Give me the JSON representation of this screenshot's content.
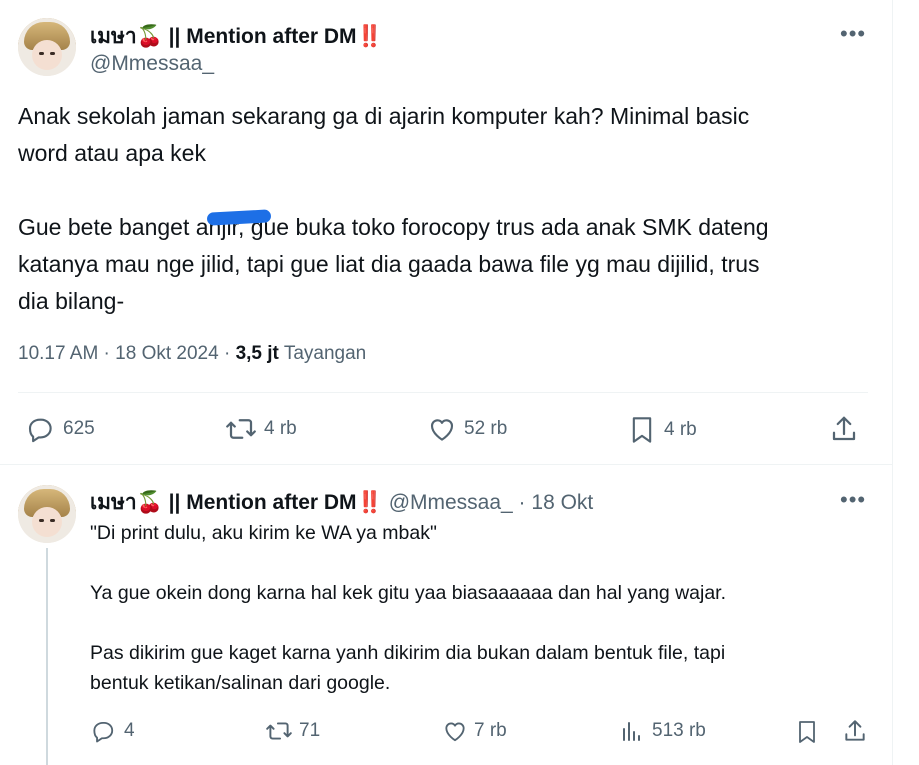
{
  "main_tweet": {
    "display_name": "เมษา🍒 || Mention after DM‼️",
    "handle": "@Mmessaa_",
    "text_lines": [
      "Anak sekolah jaman sekarang ga di ajarin komputer kah? Minimal basic",
      "word atau apa kek",
      "",
      "Gue bete banget anjir, gue buka toko forocopy trus ada anak SMK dateng",
      "katanya mau nge jilid, tapi gue liat dia gaada bawa file yg mau dijilid, trus",
      "dia bilang-"
    ],
    "time": "10.17 AM · 18 Okt 2024 · ",
    "views_count": "3,5 jt",
    "views_label": " Tayangan",
    "replies": "625",
    "retweets": "4 rb",
    "likes": "52 rb",
    "bookmarks": "4 rb"
  },
  "reply_tweet": {
    "display_name": "เมษา🍒 || Mention after DM‼️",
    "handle_date": "@Mmessaa_ · 18 Okt",
    "text_lines": [
      "\"Di print dulu, aku kirim ke WA ya mbak\"",
      "",
      "Ya gue okein dong karna hal kek gitu yaa biasaaaaaa dan hal yang wajar.",
      "",
      "Pas dikirim gue kaget karna yanh dikirim dia bukan dalam bentuk file, tapi",
      "bentuk ketikan/salinan dari google."
    ],
    "replies": "4",
    "retweets": "71",
    "likes": "7 rb",
    "views": "513 rb"
  },
  "more_label": "•••",
  "colors": {
    "muted": "#536471",
    "text": "#0f1419",
    "divider": "#eff3f4",
    "scribble": "#1d6fe6"
  },
  "icons": [
    "reply-icon",
    "retweet-icon",
    "like-icon",
    "bookmark-icon",
    "share-icon",
    "views-icon",
    "more-icon",
    "avatar"
  ]
}
